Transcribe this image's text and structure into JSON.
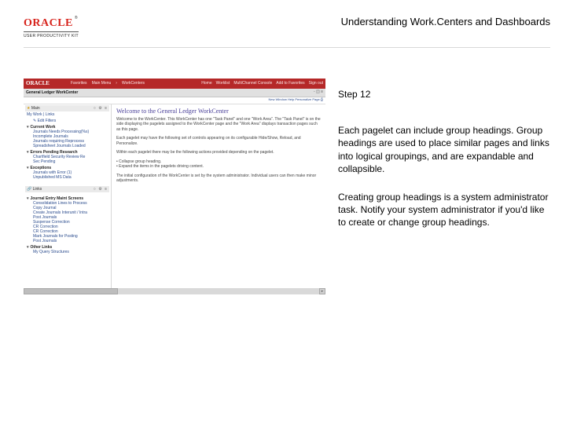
{
  "header": {
    "brand": "ORACLE",
    "brand_tm": "®",
    "brand_sub": "USER PRODUCTIVITY KIT",
    "title": "Understanding Work.Centers and Dashboards"
  },
  "guide": {
    "step_label": "Step 12",
    "para1": "Each pagelet can include group headings. Group headings are used to place similar pages and links into logical groupings, and are expandable and collapsible.",
    "para2": "Creating group headings is a system administrator task. Notify your system administrator if you'd like to create or change group headings."
  },
  "app": {
    "brand": "ORACLE",
    "topmenu": [
      "Favorites",
      "Main Menu",
      "",
      "WorkCenters"
    ],
    "topright": [
      "Home",
      "Worklist",
      "MultiChannel Console",
      "Add to Favorites",
      "Sign out"
    ],
    "greybar_title": "General Ledger WorkCenter",
    "greybar_controls": "◦ ◫ ≡",
    "actionbar_right": "New Window   Help   Personalize Page   ⎙",
    "left": {
      "main": {
        "title": "Main",
        "star": "★",
        "icons": "○ ⚙ ≡",
        "tabs": "My Work   |   Links",
        "edit_filters": "✎  Edit Filters",
        "group1": {
          "label": "Current Work",
          "items": [
            "Journals Needs Processing(%s)",
            "Incomplete Journals",
            "Journals requiring Reprocess",
            "Spreadsheet Journals Loaded"
          ]
        },
        "group2": {
          "label": "Errors Pending Research",
          "items2": [
            "Chartfield Security Review Re",
            "Sec Pending"
          ]
        },
        "group3": {
          "label": "Exceptions",
          "items3": [
            "Journals with Error (1)",
            "Unpublished MS Data"
          ]
        }
      },
      "links": {
        "title": "Links",
        "icon": "🔗",
        "icons": "○ ⚙ ≡",
        "group1": {
          "label": "Journal Entry Maint Screens",
          "items": [
            "Consolidation Lines to Process",
            "Copy Journal",
            "Create Journals Interunit / Intra",
            "Post Journals",
            "Suspense Correction",
            "CR Correction",
            "CR Correction",
            "Mark Journals for Posting",
            "Post Journals"
          ]
        },
        "other": {
          "label": "Other Links",
          "item": "My Query Structures"
        }
      }
    },
    "mainpanel": {
      "welcome_title": "Welcome to the General Ledger WorkCenter",
      "p1": "Welcome to the WorkCenter. This WorkCenter has one \"Task Panel\" and one \"Work Area\". The \"Task Panel\" is on the side displaying the pagelets assigned to the WorkCenter page and the \"Work Area\" displays transaction pages such as this page.",
      "p2": "Each pagelet may have the following set of controls appearing on its configurable Hide/Show, Reload, and Personalize.",
      "p3": "Within each pagelet there may be the following actions provided depending on the pagelet.",
      "bullets": [
        "Collapse group heading.",
        "Expand the items in the pagelets driving content."
      ],
      "p4": "The initial configuration of the WorkCenter is set by the system administrator. Individual users can then make minor adjustments."
    }
  }
}
